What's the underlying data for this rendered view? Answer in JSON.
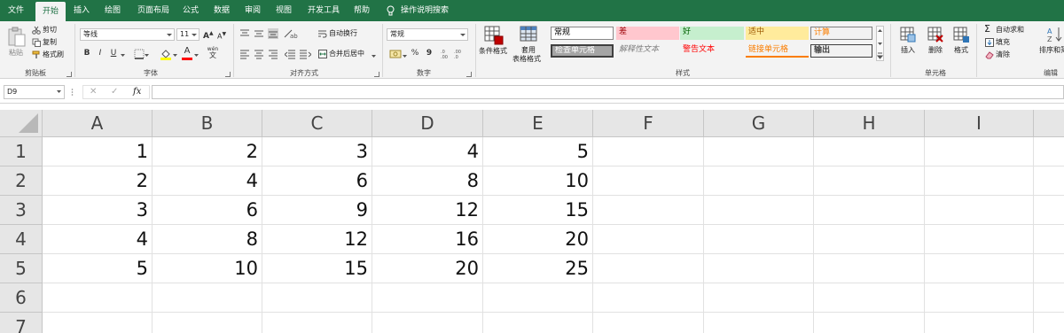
{
  "tabs": [
    {
      "label": "文件"
    },
    {
      "label": "开始"
    },
    {
      "label": "插入"
    },
    {
      "label": "绘图"
    },
    {
      "label": "页面布局"
    },
    {
      "label": "公式"
    },
    {
      "label": "数据"
    },
    {
      "label": "审阅"
    },
    {
      "label": "视图"
    },
    {
      "label": "开发工具"
    },
    {
      "label": "帮助"
    }
  ],
  "tell_me": "操作说明搜索",
  "clipboard": {
    "paste": "粘贴",
    "cut": "剪切",
    "copy": "复制",
    "format_painter": "格式刷",
    "group": "剪贴板"
  },
  "font": {
    "name": "等线",
    "size": "11",
    "grow": "A",
    "shrink": "A",
    "bold": "B",
    "italic": "I",
    "underline": "U",
    "font_color_letter": "A",
    "phonetic": "wén",
    "group": "字体"
  },
  "alignment": {
    "wrap": "自动换行",
    "merge": "合并后居中",
    "group": "对齐方式"
  },
  "number": {
    "format": "常规",
    "percent": "%",
    "comma": "9",
    "group": "数字"
  },
  "styles": {
    "conditional": "条件格式",
    "table_l1": "套用",
    "table_l2": "表格格式",
    "cells": [
      {
        "label": "常规",
        "bg": "#ffffff",
        "fg": "#000000"
      },
      {
        "label": "差",
        "bg": "#ffc7ce",
        "fg": "#9c0006"
      },
      {
        "label": "好",
        "bg": "#c6efce",
        "fg": "#006100"
      },
      {
        "label": "适中",
        "bg": "#ffeb9c",
        "fg": "#9c5700"
      },
      {
        "label": "计算",
        "bg": "#f2f2f2",
        "fg": "#fa7d00"
      },
      {
        "label": "检查单元格",
        "bg": "#a5a5a5",
        "fg": "#ffffff"
      },
      {
        "label": "解释性文本",
        "bg": "#f3f3f3",
        "fg": "#7f7f7f"
      },
      {
        "label": "警告文本",
        "bg": "#f3f3f3",
        "fg": "#ff0000"
      },
      {
        "label": "链接单元格",
        "bg": "#f3f3f3",
        "fg": "#fa7d00"
      },
      {
        "label": "输出",
        "bg": "#f2f2f2",
        "fg": "#3f3f3f"
      }
    ],
    "group": "样式"
  },
  "cells_group": {
    "insert": "插入",
    "delete": "删除",
    "format": "格式",
    "group": "单元格"
  },
  "editing": {
    "autosum": "自动求和",
    "fill": "填充",
    "clear": "清除",
    "sort": "排序和筛",
    "group": "编辑"
  },
  "formula_bar": {
    "name_box": "D9",
    "cancel": "✕",
    "enter": "✓",
    "fx": "fx",
    "value": ""
  },
  "sheet": {
    "columns": [
      "A",
      "B",
      "C",
      "D",
      "E",
      "F",
      "G",
      "H",
      "I"
    ],
    "rows": [
      {
        "num": "1",
        "cells": [
          "1",
          "2",
          "3",
          "4",
          "5",
          "",
          "",
          "",
          ""
        ]
      },
      {
        "num": "2",
        "cells": [
          "2",
          "4",
          "6",
          "8",
          "10",
          "",
          "",
          "",
          ""
        ]
      },
      {
        "num": "3",
        "cells": [
          "3",
          "6",
          "9",
          "12",
          "15",
          "",
          "",
          "",
          ""
        ]
      },
      {
        "num": "4",
        "cells": [
          "4",
          "8",
          "12",
          "16",
          "20",
          "",
          "",
          "",
          ""
        ]
      },
      {
        "num": "5",
        "cells": [
          "5",
          "10",
          "15",
          "20",
          "25",
          "",
          "",
          "",
          ""
        ]
      },
      {
        "num": "6",
        "cells": [
          "",
          "",
          "",
          "",
          "",
          "",
          "",
          "",
          ""
        ]
      },
      {
        "num": "7",
        "cells": [
          "",
          "",
          "",
          "",
          "",
          "",
          "",
          "",
          ""
        ]
      }
    ]
  },
  "colors": {
    "accent": "#217346",
    "ribbon_bg": "#f3f3f3",
    "header_bg": "#e6e6e6",
    "gridline": "#e1e1e1"
  }
}
